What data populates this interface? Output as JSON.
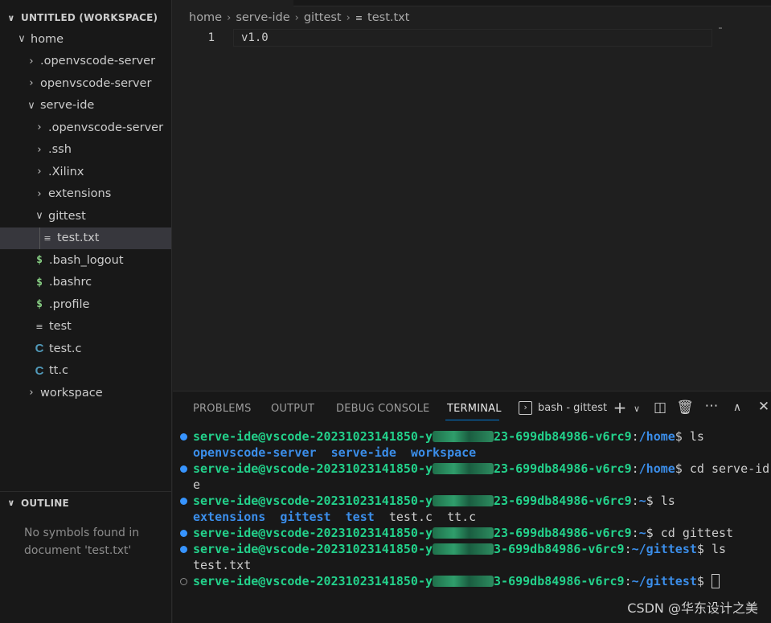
{
  "sidebar": {
    "explorer_title": "UNTITLED (WORKSPACE)",
    "tree": [
      {
        "label": "home",
        "twisty": "open",
        "icon": "",
        "indent": 0
      },
      {
        "label": ".openvscode-server",
        "twisty": "closed",
        "icon": "",
        "indent": 1
      },
      {
        "label": "openvscode-server",
        "twisty": "closed",
        "icon": "",
        "indent": 1
      },
      {
        "label": "serve-ide",
        "twisty": "open",
        "icon": "",
        "indent": 1
      },
      {
        "label": ".openvscode-server",
        "twisty": "closed",
        "icon": "",
        "indent": 2
      },
      {
        "label": ".ssh",
        "twisty": "closed",
        "icon": "",
        "indent": 2
      },
      {
        "label": ".Xilinx",
        "twisty": "closed",
        "icon": "",
        "indent": 2
      },
      {
        "label": "extensions",
        "twisty": "closed",
        "icon": "",
        "indent": 2
      },
      {
        "label": "gittest",
        "twisty": "open",
        "icon": "",
        "indent": 2
      },
      {
        "label": "test.txt",
        "twisty": "",
        "icon": "lines-file-icon",
        "indent": 3,
        "selected": true
      },
      {
        "label": ".bash_logout",
        "twisty": "",
        "icon": "dollar-file-icon",
        "indent": 2
      },
      {
        "label": ".bashrc",
        "twisty": "",
        "icon": "dollar-file-icon",
        "indent": 2
      },
      {
        "label": ".profile",
        "twisty": "",
        "icon": "dollar-file-icon",
        "indent": 2
      },
      {
        "label": "test",
        "twisty": "",
        "icon": "lines-file-icon",
        "indent": 2
      },
      {
        "label": "test.c",
        "twisty": "",
        "icon": "c-file-icon",
        "indent": 2
      },
      {
        "label": "tt.c",
        "twisty": "",
        "icon": "c-file-icon",
        "indent": 2
      },
      {
        "label": "workspace",
        "twisty": "closed",
        "icon": "",
        "indent": 1
      }
    ],
    "outline_title": "OUTLINE",
    "outline_message": "No symbols found in document 'test.txt'"
  },
  "editor": {
    "breadcrumbs": [
      "home",
      "serve-ide",
      "gittest",
      "test.txt"
    ],
    "line_number": "1",
    "code": "v1.0"
  },
  "panel": {
    "tabs": [
      "PROBLEMS",
      "OUTPUT",
      "DEBUG CONSOLE",
      "TERMINAL"
    ],
    "active_tab": "TERMINAL",
    "terminal_name": "bash - gittest",
    "terminal_lines": [
      {
        "dot": "filled",
        "user": "serve-ide@vscode-20231023141850-y",
        "host_tail": "23-699db84986-v6rc9",
        "path": "/home",
        "cmd": " ls"
      },
      {
        "dot": "none",
        "listing": [
          {
            "text": "openvscode-server",
            "dir": true
          },
          {
            "text": "serve-ide",
            "dir": true
          },
          {
            "text": "workspace",
            "dir": true
          }
        ]
      },
      {
        "dot": "filled",
        "user": "serve-ide@vscode-20231023141850-y",
        "host_tail": "23-699db84986-v6rc9",
        "path": "/home",
        "cmd": " cd serve-id"
      },
      {
        "dot": "none",
        "plain": "e"
      },
      {
        "dot": "filled",
        "user": "serve-ide@vscode-20231023141850-y",
        "host_tail": "23-699db84986-v6rc9",
        "path": "~",
        "cmd": " ls"
      },
      {
        "dot": "none",
        "listing": [
          {
            "text": "extensions",
            "dir": true
          },
          {
            "text": "gittest",
            "dir": true
          },
          {
            "text": "test",
            "dir": true
          },
          {
            "text": "test.c",
            "dir": false
          },
          {
            "text": "tt.c",
            "dir": false
          }
        ]
      },
      {
        "dot": "filled",
        "user": "serve-ide@vscode-20231023141850-y",
        "host_tail": "23-699db84986-v6rc9",
        "path": "~",
        "cmd": " cd gittest"
      },
      {
        "dot": "filled",
        "user": "serve-ide@vscode-20231023141850-y",
        "host_tail": "3-699db84986-v6rc9",
        "path": "~/gittest",
        "cmd": " ls"
      },
      {
        "dot": "none",
        "plain": "test.txt"
      },
      {
        "dot": "hollow",
        "user": "serve-ide@vscode-20231023141850-y",
        "host_tail": "3-699db84986-v6rc9",
        "path": "~/gittest",
        "cmd": " ",
        "cursor": true
      }
    ]
  },
  "watermark": "CSDN @华东设计之美",
  "colors": {
    "accent": "#0078d4",
    "prompt_user": "#23d18b",
    "prompt_path": "#3b8eea",
    "dot": "#3794ff"
  }
}
